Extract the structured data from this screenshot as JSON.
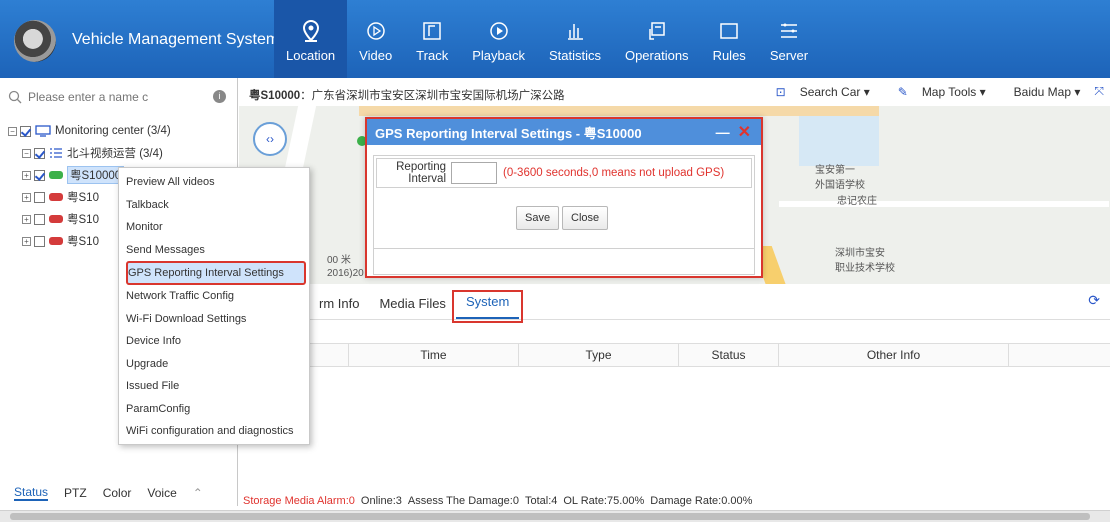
{
  "app": {
    "title": "Vehicle Management System"
  },
  "nav": [
    {
      "label": "Location",
      "icon": "location-pin-icon",
      "active": true
    },
    {
      "label": "Video",
      "icon": "play-circle-icon"
    },
    {
      "label": "Track",
      "icon": "track-icon"
    },
    {
      "label": "Playback",
      "icon": "playback-icon"
    },
    {
      "label": "Statistics",
      "icon": "bar-chart-icon"
    },
    {
      "label": "Operations",
      "icon": "operations-icon"
    },
    {
      "label": "Rules",
      "icon": "rules-icon"
    },
    {
      "label": "Server",
      "icon": "server-icon"
    }
  ],
  "search": {
    "placeholder": "Please enter a name c"
  },
  "tree": {
    "root": "Monitoring center (3/4)",
    "group": "北斗视频运营 (3/4)",
    "vehicles": [
      "粤S10000",
      "粤S10",
      "粤S10",
      "粤S10"
    ]
  },
  "left_tabs": [
    "Status",
    "PTZ",
    "Color",
    "Voice"
  ],
  "address": {
    "plate": "粤S10000",
    "sep": "：",
    "location": "广东省深圳市宝安区深圳市宝安国际机场广深公路"
  },
  "map_tools": {
    "search_car": "Search Car",
    "map_tools": "Map Tools",
    "baidu_map": "Baidu Map"
  },
  "map": {
    "poi1": "宝安第一\n外国语学校",
    "poi2": "忠记农庄",
    "poi3": "深圳市宝安\n职业技术学校",
    "scale": "00 米",
    "copyright": "2016)20"
  },
  "context_menu": [
    "Preview All videos",
    "Talkback",
    "Monitor",
    "Send Messages",
    "GPS Reporting Interval Settings",
    "Network Traffic Config",
    "Wi-Fi Download Settings",
    "Device Info",
    "Upgrade",
    "Issued File",
    "ParamConfig",
    "WiFi configuration and diagnostics"
  ],
  "dialog": {
    "title": "GPS Reporting Interval Settings - 粤S10000",
    "field_label": "Reporting Interval",
    "hint": "(0-3600 seconds,0 means not upload GPS)",
    "save": "Save",
    "close": "Close"
  },
  "panel_tabs": [
    "rm Info",
    "Media Files",
    "System"
  ],
  "table_headers": [
    "Time",
    "Type",
    "Status",
    "Other Info"
  ],
  "status": {
    "storage": "Storage Media Alarm:0",
    "online": "Online:3",
    "damage": "Assess The Damage:0",
    "total": "Total:4",
    "ol_rate": "OL Rate:75.00%",
    "damage_rate": "Damage Rate:0.00%"
  },
  "colors": {
    "accent": "#1d63b8",
    "highlight": "#d9362e",
    "topbar": "#2e7fd3"
  }
}
